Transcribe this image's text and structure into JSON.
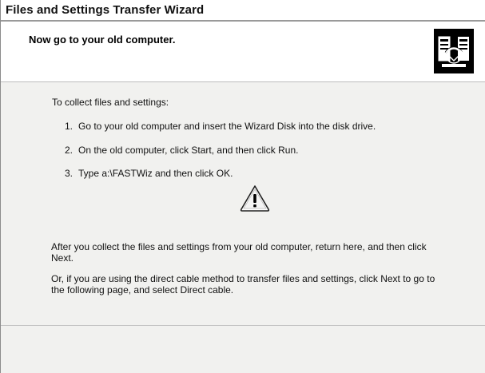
{
  "window": {
    "title": "Files and Settings Transfer Wizard"
  },
  "header": {
    "heading": "Now go to your old computer.",
    "icon": "transfer-wizard-icon"
  },
  "content": {
    "intro": "To collect files and settings:",
    "steps": [
      {
        "number": "1.",
        "text": "Go to your old computer and insert the Wizard Disk into the disk drive."
      },
      {
        "number": "2.",
        "text": "On the old computer, click Start, and then click Run."
      },
      {
        "number": "3.",
        "text": "Type a:\\FASTWiz and then click OK."
      }
    ],
    "warning_icon": "warning-icon",
    "paragraph1": "After you collect the files and settings from your old computer, return here, and then click Next.",
    "paragraph2": "Or, if you are using the direct cable method to transfer files and settings, click Next to go to the following page, and select Direct cable."
  }
}
